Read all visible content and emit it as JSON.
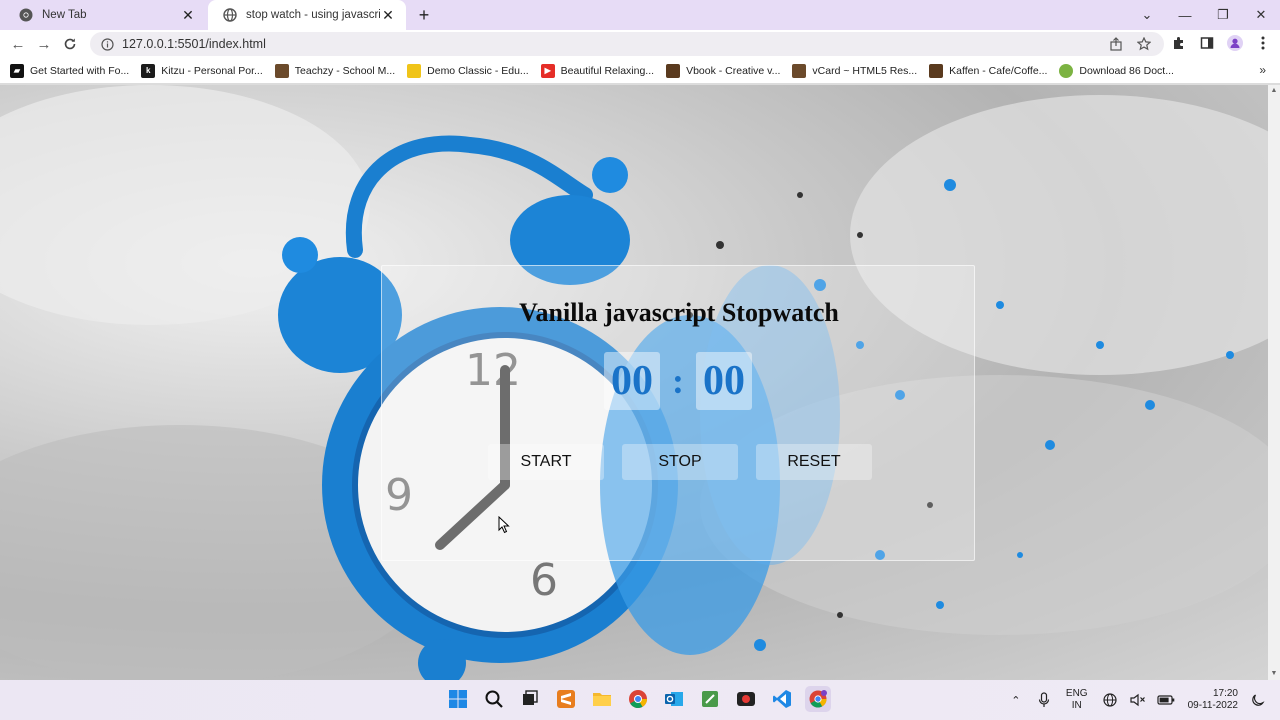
{
  "browser": {
    "tabs": [
      {
        "title": "New Tab",
        "icon": "chrome-icon",
        "active": false
      },
      {
        "title": "stop watch - using javascript",
        "icon": "globe-icon",
        "active": true
      }
    ],
    "url": "127.0.0.1:5501/index.html",
    "bookmarks": [
      {
        "label": "Get Started with Fo...",
        "color": "#111111"
      },
      {
        "label": "Kitzu - Personal Por...",
        "color": "#1b1b1b"
      },
      {
        "label": "Teachzy - School M...",
        "color": "#6b4a2b"
      },
      {
        "label": "Demo Classic - Edu...",
        "color": "#f0c419"
      },
      {
        "label": "Beautiful Relaxing...",
        "color": "#e52d27"
      },
      {
        "label": "Vbook - Creative v...",
        "color": "#5a3a1e"
      },
      {
        "label": "vCard ~ HTML5 Res...",
        "color": "#6b4a2b"
      },
      {
        "label": "Kaffen - Cafe/Coffe...",
        "color": "#5a3a1e"
      },
      {
        "label": "Download 86 Doct...",
        "color": "#7cb342"
      }
    ]
  },
  "stopwatch": {
    "title": "Vanilla javascript Stopwatch",
    "minutes": "00",
    "separator": ":",
    "seconds": "00",
    "start_label": "START",
    "stop_label": "STOP",
    "reset_label": "RESET",
    "digit_color": "#1a73c8"
  },
  "taskbar": {
    "language": "ENG",
    "region": "IN",
    "time": "17:20",
    "date": "09-11-2022"
  }
}
